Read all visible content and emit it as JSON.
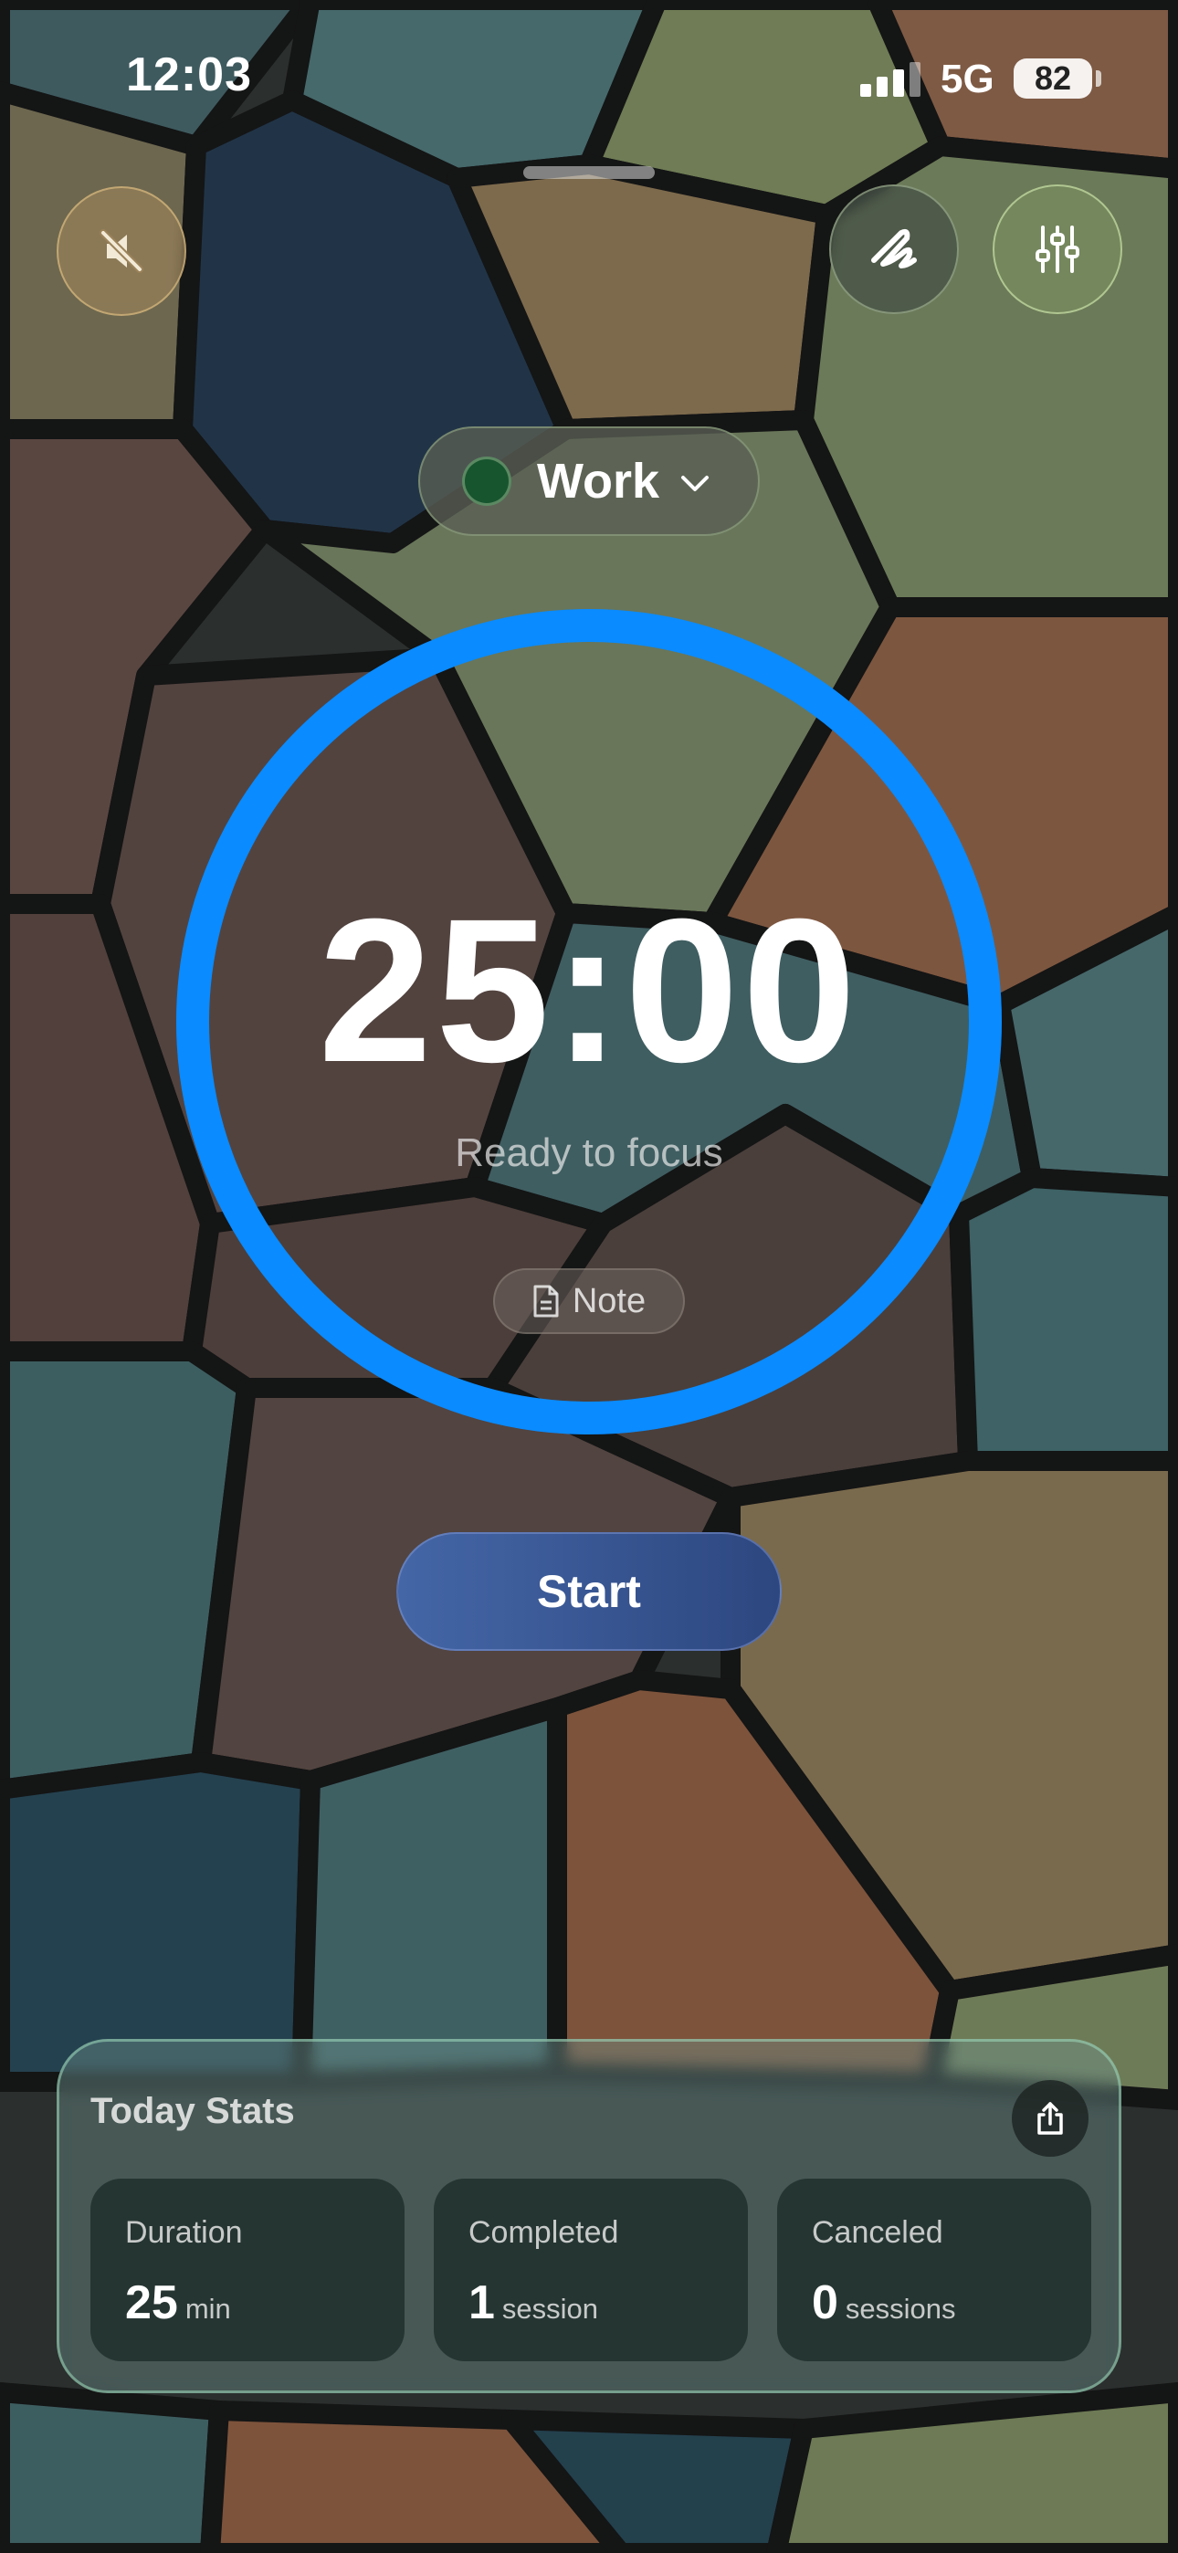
{
  "status_bar": {
    "time": "12:03",
    "network": "5G",
    "battery": "82"
  },
  "top_bar": {
    "mute_icon": "speaker-muted-icon",
    "pen_icon": "scribble-pen-icon",
    "settings_icon": "sliders-icon"
  },
  "category": {
    "label": "Work",
    "color": "#17552f"
  },
  "timer": {
    "time": "25:00",
    "status": "Ready to focus",
    "note_label": "Note",
    "progress": 1.0,
    "ring_color": "#0a8bff"
  },
  "start_label": "Start",
  "stats": {
    "title": "Today Stats",
    "tiles": [
      {
        "label": "Duration",
        "value": "25",
        "unit": "min"
      },
      {
        "label": "Completed",
        "value": "1",
        "unit": "session"
      },
      {
        "label": "Canceled",
        "value": "0",
        "unit": "sessions"
      }
    ]
  }
}
